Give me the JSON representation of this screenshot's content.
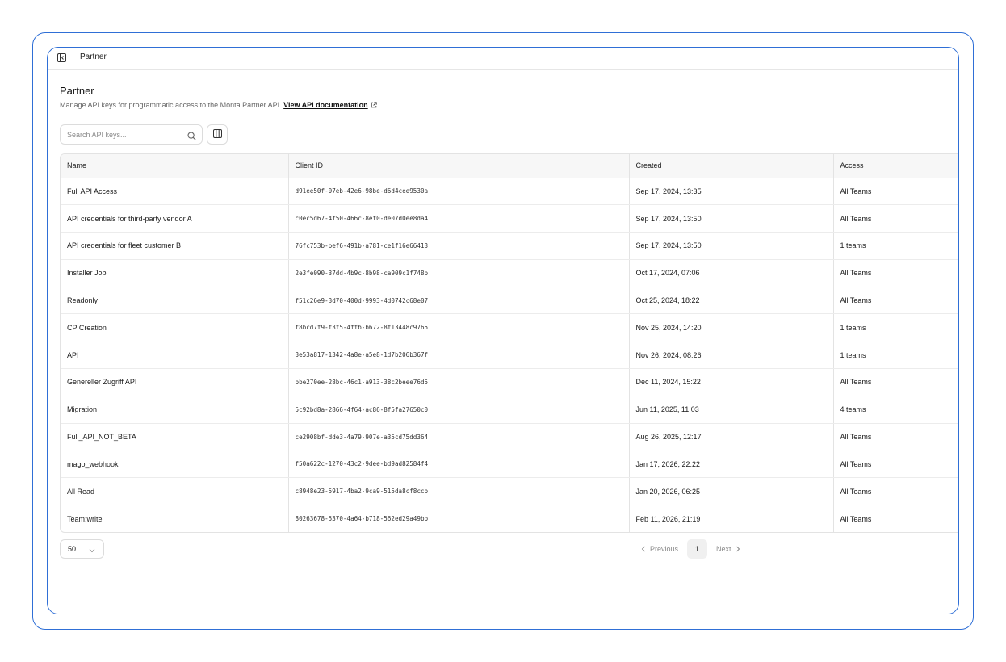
{
  "topbar": {
    "title": "Partner",
    "toggle_icon": "sidebar-collapse-icon"
  },
  "header": {
    "title": "Partner",
    "description": "Manage API keys for programmatic access to the Monta Partner API.",
    "doc_link": "View API documentation",
    "doc_link_icon": "external-link-icon"
  },
  "search": {
    "placeholder": "Search API keys...",
    "value": "",
    "icon": "search-icon"
  },
  "toolbar": {
    "columns_icon": "columns-icon"
  },
  "table": {
    "columns": [
      "Name",
      "Client ID",
      "Created",
      "Access"
    ],
    "rows": [
      {
        "name": "Full API Access",
        "client_id": "d91ee50f-07eb-42e6-98be-d6d4cee9530a",
        "created": "Sep 17, 2024, 13:35",
        "access": "All Teams"
      },
      {
        "name": "API credentials for third-party vendor A",
        "client_id": "c0ec5d67-4f50-466c-8ef0-de07d0ee8da4",
        "created": "Sep 17, 2024, 13:50",
        "access": "All Teams"
      },
      {
        "name": "API credentials for fleet customer B",
        "client_id": "76fc753b-bef6-491b-a781-ce1f16e66413",
        "created": "Sep 17, 2024, 13:50",
        "access": "1 teams"
      },
      {
        "name": "Installer Job",
        "client_id": "2e3fe090-37dd-4b9c-8b98-ca909c1f748b",
        "created": "Oct 17, 2024, 07:06",
        "access": "All Teams"
      },
      {
        "name": "Readonly",
        "client_id": "f51c26e9-3d70-400d-9993-4d0742c68e07",
        "created": "Oct 25, 2024, 18:22",
        "access": "All Teams"
      },
      {
        "name": "CP Creation",
        "client_id": "f8bcd7f9-f3f5-4ffb-b672-8f13448c9765",
        "created": "Nov 25, 2024, 14:20",
        "access": "1 teams"
      },
      {
        "name": "API",
        "client_id": "3e53a817-1342-4a8e-a5e8-1d7b206b367f",
        "created": "Nov 26, 2024, 08:26",
        "access": "1 teams"
      },
      {
        "name": "Genereller Zugriff API",
        "client_id": "bbe270ee-28bc-46c1-a913-38c2beee76d5",
        "created": "Dec 11, 2024, 15:22",
        "access": "All Teams"
      },
      {
        "name": "Migration",
        "client_id": "5c92bd8a-2866-4f64-ac86-8f5fa27650c0",
        "created": "Jun 11, 2025, 11:03",
        "access": "4 teams"
      },
      {
        "name": "Full_API_NOT_BETA",
        "client_id": "ce2908bf-dde3-4a79-907e-a35cd75dd364",
        "created": "Aug 26, 2025, 12:17",
        "access": "All Teams"
      },
      {
        "name": "mago_webhook",
        "client_id": "f50a622c-1270-43c2-9dee-bd9ad82584f4",
        "created": "Jan 17, 2026, 22:22",
        "access": "All Teams"
      },
      {
        "name": "All Read",
        "client_id": "c8948e23-5917-4ba2-9ca9-515da8cf8ccb",
        "created": "Jan 20, 2026, 06:25",
        "access": "All Teams"
      },
      {
        "name": "Team:write",
        "client_id": "80263678-5370-4a64-b718-562ed29a49bb",
        "created": "Feb 11, 2026, 21:19",
        "access": "All Teams"
      }
    ]
  },
  "footer": {
    "page_size": "50",
    "page_size_icon": "chevron-down-icon",
    "previous_label": "Previous",
    "next_label": "Next",
    "current_page": "1"
  },
  "colors": {
    "frame_border": "#2f6fd6",
    "header_bg": "#f7f7f7",
    "page_active_bg": "#f0f0f0"
  }
}
